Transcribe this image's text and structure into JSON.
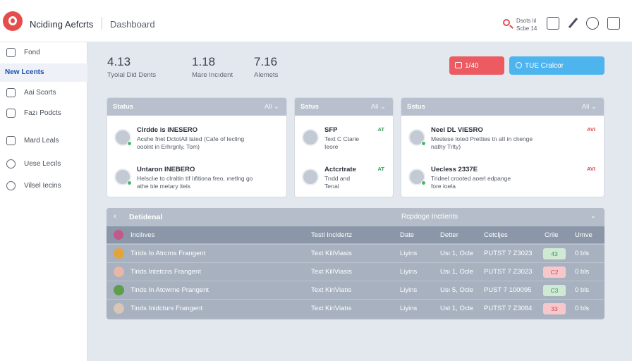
{
  "header": {
    "brand": "Ncidiıng Aefcrts",
    "breadcrumb": "Dashboard",
    "user_line1": "Dsots lıl",
    "user_line2": "Scbe 14"
  },
  "sidebar": {
    "items": [
      {
        "label": "Fond",
        "icon": "home-icon"
      },
      {
        "label": "New Lcents",
        "icon": "none",
        "active": true
      },
      {
        "label": "Aai Scorts",
        "icon": "grid-icon"
      },
      {
        "label": "Fazı Podcts",
        "icon": "document-icon"
      },
      {
        "label": "Mard Leals",
        "icon": "clipboard-icon"
      },
      {
        "label": "Uese Lecıls",
        "icon": "link-icon"
      },
      {
        "label": "Vilsel Iecins",
        "icon": "globe-icon"
      }
    ]
  },
  "metrics": [
    {
      "value": "4.13",
      "label": "Tyoial Did Dents"
    },
    {
      "value": "1.18",
      "label": "Mare Incıdent"
    },
    {
      "value": "7.16",
      "label": "Alemets"
    }
  ],
  "actions": {
    "primary_red": "1/40",
    "primary_blue": "TUE Cralcor"
  },
  "panels": [
    {
      "title": "Status",
      "filter": "All ⌄",
      "entries": [
        {
          "name": "Clrdde is INESERO",
          "desc1": "Acshe fnet DctotAll lated (Cafe of Iecling",
          "desc2": "ooolnt in Erhrgnly, Tom)",
          "tag": "",
          "tag_color": ""
        },
        {
          "name": "Untaron INEBERO",
          "desc1": "Helsclıe to clraltin tif Iıfitiona freo, ınetlng go",
          "desc2": "athe tıle metary iteis",
          "tag": "",
          "tag_color": ""
        }
      ]
    },
    {
      "title": "Sstus",
      "filter": "All ⌄",
      "entries": [
        {
          "name": "SFP",
          "desc1": "Text C Ctarie",
          "desc2": "Ieore",
          "tag": "AT",
          "tag_color": "green"
        },
        {
          "name": "Actcrtrate",
          "desc1": "Trıdd and",
          "desc2": "Terıal",
          "tag": "AT",
          "tag_color": "green"
        }
      ]
    },
    {
      "title": "Sstus",
      "filter": "All ⌄",
      "entries": [
        {
          "name": "Neel DL VIESRO",
          "desc1": "Mestese loted Pretties tn aII in clıenge",
          "desc2": "nathy Trlty)",
          "tag": "AVI",
          "tag_color": "red"
        },
        {
          "name": "Uecless 2337E",
          "desc1": "Trideel crooted aoerl edpange",
          "desc2": "fore ioela",
          "tag": "AVI",
          "tag_color": "red"
        }
      ]
    }
  ],
  "table": {
    "title": "Detidenal",
    "subtitle": "Rcpdoge Inctients",
    "columns": [
      "Incilıves",
      "Testl Incldertz",
      "Date",
      "Detter",
      "Cetcljes",
      "Crile",
      "Umve"
    ],
    "rows": [
      {
        "name": "Tirids Io Atrcrns Frangent",
        "type": "Text KiliViasis",
        "c3": "Liyins",
        "c4": "Usı 1, Ocle",
        "c5": "PUTST 7 Z3023",
        "badge": "43",
        "badge_color": "green",
        "c7": "0 bls",
        "avatar_color": "#e3a53a"
      },
      {
        "name": "Tirids Intetcrıs Frangent",
        "type": "Text KiliViasis",
        "c3": "Liyins",
        "c4": "Usı 1, Ocle",
        "c5": "PUTST 7 Z3023",
        "badge": "C2",
        "badge_color": "red",
        "c7": "0 bls",
        "avatar_color": "#e8b6a6"
      },
      {
        "name": "Tinds In Atcwrne Prangent",
        "type": "Text KiriViatıs",
        "c3": "Liyins",
        "c4": "Usı 5, Ocle",
        "c5": "PUST 7 100095",
        "badge": "C3",
        "badge_color": "green",
        "c7": "0 bls",
        "avatar_color": "#5f9d4b"
      },
      {
        "name": "Tinds Inidcturs Frangent",
        "type": "Text KiriViatıs",
        "c3": "Liyins",
        "c4": "Ust 1, Ocle",
        "c5": "PUTST 7 Z3084",
        "badge": "33",
        "badge_color": "red",
        "c7": "0 bls",
        "avatar_color": "#d9c6b8"
      }
    ]
  }
}
